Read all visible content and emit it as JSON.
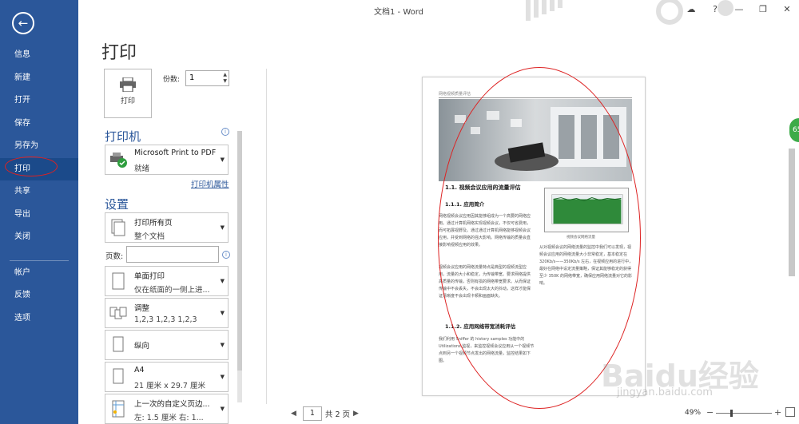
{
  "window": {
    "title": "文档1 - Word",
    "controls": {
      "weather": "☁",
      "help": "?",
      "minimize": "—",
      "restore": "❐",
      "close": "✕"
    }
  },
  "nav": {
    "back_icon": "←",
    "items": [
      {
        "label": "信息"
      },
      {
        "label": "新建"
      },
      {
        "label": "打开"
      },
      {
        "label": "保存"
      },
      {
        "label": "另存为"
      },
      {
        "label": "打印",
        "active": true
      },
      {
        "label": "共享"
      },
      {
        "label": "导出"
      },
      {
        "label": "关闭"
      },
      {
        "label": "帐户"
      },
      {
        "label": "反馈"
      },
      {
        "label": "选项"
      }
    ]
  },
  "print": {
    "heading": "打印",
    "print_button": "打印",
    "copies_label": "份数:",
    "copies_value": "1",
    "printer_section": "打印机",
    "printer_name": "Microsoft Print to PDF",
    "printer_status": "就绪",
    "printer_props": "打印机属性",
    "settings_section": "设置",
    "pages_label": "页数:",
    "pages_value": "",
    "info_icon": "i",
    "dropdown_arrow": "▼",
    "options": [
      {
        "line1": "打印所有页",
        "line2": "整个文档"
      },
      {
        "line1": "单面打印",
        "line2": "仅在纸面的一侧上进..."
      },
      {
        "line1": "调整",
        "line2": "1,2,3     1,2,3     1,2,3"
      },
      {
        "line1": "纵向",
        "line2": ""
      },
      {
        "line1": "A4",
        "line2": "21 厘米 x 29.7 厘米"
      },
      {
        "line1": "上一次的自定义页边...",
        "line2": "左: 1.5 厘米    右: 1..."
      }
    ]
  },
  "preview": {
    "header_text": "网络视频质量评估",
    "heading_1": "1.1.   视频会议应用的流量评估",
    "heading_1_1": "1.1.1.   应用简介",
    "paragraph_1": "网络视频会议应用因其能够组成为一个高要的网络应用。通过计算机网络实现视频会议，不仅可省费用，而可拓展视野及。通过通过计算机网络能够视频会议应用，并受到网络的强大影响。网络传输的质量会直接影响视频应用的效果。",
    "paragraph_2": "视频会议应用的网络流量特点是典型的视频流型应用，流量的大小和稳定，为传输带宽。要求网络提供高质量的传输，否则有损的网络带宽要求。从而保证传输中不会丢失，不会出现太大的抖动，这样才能保证清晰度不会出现卡顿和画面缺失。",
    "heading_1_2": "1.1.2.   应用网络带宽消耗评估",
    "paragraph_3": "我们利用 Sniffer 的 history samples 功能中的 Utilizations 监视，来监控视频会议应用从一个视频节点到另一个视频节点发出的网络流量，监控结果如下图。",
    "chart_caption": "视频会议网络流量",
    "paragraph_4": "从对视频会议的网络流量的监控中我们可以发现，视频会议应用的网络流量大小非常稳定，基本稳定在 320Kb/s——350Kb/s 左右，在视频应用的进行中，最好在网络中设定流量策略，保证其能够稳定的获得至少 350K 的网络带宽，确保应用网络流量对它的影响。"
  },
  "pager": {
    "prev": "◀",
    "page": "1",
    "total": "共 2 页",
    "next": "▶"
  },
  "zoom": {
    "percent": "49%",
    "minus": "−",
    "plus": "+"
  },
  "badge": "65",
  "watermark": {
    "brand": "Baidu经验",
    "url": "jingyan.baidu.com"
  }
}
